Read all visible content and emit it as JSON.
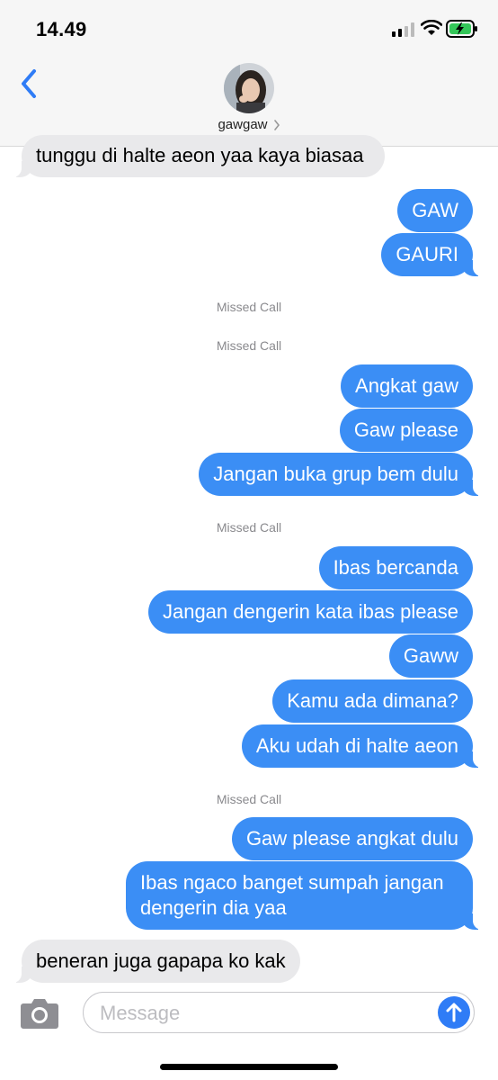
{
  "status_bar": {
    "time": "14.49"
  },
  "header": {
    "contact_name": "gawgaw"
  },
  "messages": [
    {
      "text": "tunggu di halte aeon yaa kaya biasaa",
      "direction": "incoming"
    },
    {
      "text": "GAW",
      "direction": "outgoing"
    },
    {
      "text": "GAURI",
      "direction": "outgoing"
    },
    {
      "text": "Missed Call",
      "direction": "system"
    },
    {
      "text": "Missed Call",
      "direction": "system"
    },
    {
      "text": "Angkat gaw",
      "direction": "outgoing"
    },
    {
      "text": "Gaw please",
      "direction": "outgoing"
    },
    {
      "text": "Jangan buka grup bem dulu",
      "direction": "outgoing"
    },
    {
      "text": "Missed Call",
      "direction": "system"
    },
    {
      "text": "Ibas bercanda",
      "direction": "outgoing"
    },
    {
      "text": "Jangan dengerin kata ibas please",
      "direction": "outgoing"
    },
    {
      "text": "Gaww",
      "direction": "outgoing"
    },
    {
      "text": "Kamu ada dimana?",
      "direction": "outgoing"
    },
    {
      "text": "Aku udah di halte aeon",
      "direction": "outgoing"
    },
    {
      "text": "Missed Call",
      "direction": "system"
    },
    {
      "text": "Gaw please angkat dulu",
      "direction": "outgoing"
    },
    {
      "text": "Ibas ngaco banget sumpah jangan dengerin dia yaa",
      "direction": "outgoing"
    },
    {
      "text": "beneran juga gapapa ko kak",
      "direction": "incoming"
    }
  ],
  "composer": {
    "placeholder": "Message"
  },
  "icons": {
    "back": "chevron-left-icon",
    "camera": "camera-icon",
    "send": "arrow-up-icon",
    "signal": "cellular-signal-icon",
    "wifi": "wifi-icon",
    "battery": "battery-charging-icon"
  },
  "colors": {
    "outgoing_bubble": "#3b8ef5",
    "incoming_bubble": "#e9e9eb",
    "accent": "#2f7cf6",
    "system_text": "#8a8a8e"
  }
}
